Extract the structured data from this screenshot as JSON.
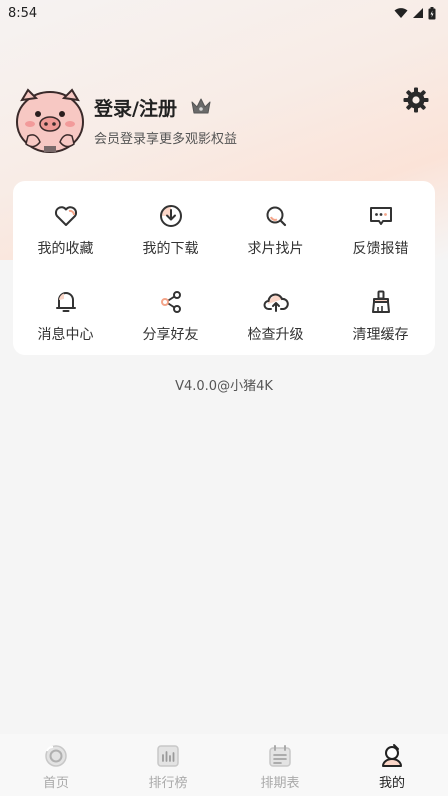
{
  "status_bar": {
    "time": "8:54"
  },
  "profile": {
    "login_label": "登录/注册",
    "subtitle": "会员登录享更多观影权益"
  },
  "grid": [
    {
      "label": "我的收藏",
      "icon": "heart-icon"
    },
    {
      "label": "我的下载",
      "icon": "download-icon"
    },
    {
      "label": "求片找片",
      "icon": "search-film-icon"
    },
    {
      "label": "反馈报错",
      "icon": "feedback-icon"
    },
    {
      "label": "消息中心",
      "icon": "bell-icon"
    },
    {
      "label": "分享好友",
      "icon": "share-icon"
    },
    {
      "label": "检查升级",
      "icon": "cloud-upload-icon"
    },
    {
      "label": "清理缓存",
      "icon": "brush-icon"
    }
  ],
  "version": "V4.0.0@小猪4K",
  "bottom_nav": [
    {
      "label": "首页",
      "icon": "home-icon",
      "active": false
    },
    {
      "label": "排行榜",
      "icon": "ranking-icon",
      "active": false
    },
    {
      "label": "排期表",
      "icon": "calendar-icon",
      "active": false
    },
    {
      "label": "我的",
      "icon": "profile-icon",
      "active": true
    }
  ],
  "colors": {
    "accent": "#f4a58a",
    "background": "#f5f5f5"
  }
}
